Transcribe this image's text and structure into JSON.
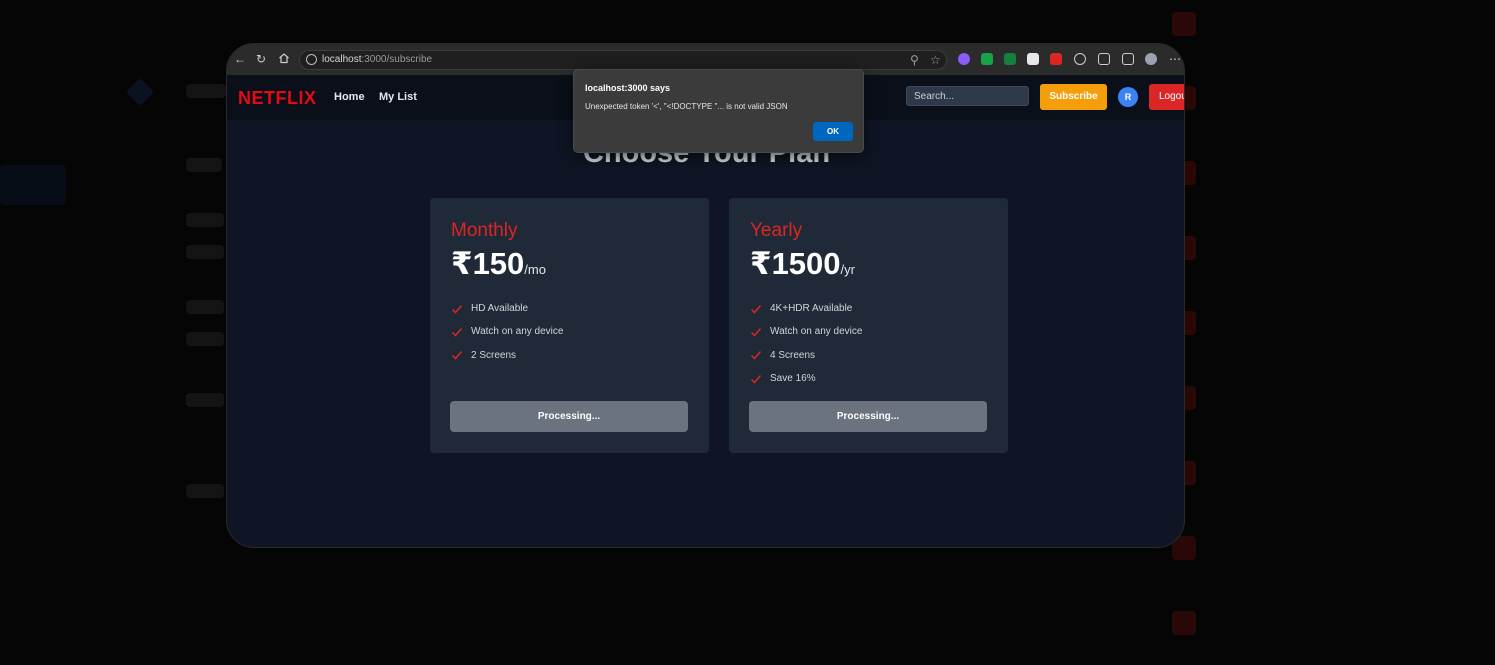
{
  "browser": {
    "url_host": "localhost",
    "url_path": ":3000/subscribe"
  },
  "app": {
    "logo": "NETFLIX",
    "nav": {
      "home": "Home",
      "my_list": "My List"
    },
    "search_placeholder": "Search...",
    "subscribe_label": "Subscribe",
    "avatar_initial": "R",
    "logout_label": "Logou",
    "brand_color": "#e50914"
  },
  "page": {
    "title": "Choose Your Plan"
  },
  "plans": [
    {
      "name": "Monthly",
      "amount": "₹150",
      "period": "/mo",
      "features": [
        "HD Available",
        "Watch on any device",
        "2 Screens"
      ],
      "button": "Processing..."
    },
    {
      "name": "Yearly",
      "amount": "₹1500",
      "period": "/yr",
      "features": [
        "4K+HDR Available",
        "Watch on any device",
        "4 Screens",
        "Save 16%"
      ],
      "button": "Processing..."
    }
  ],
  "alert": {
    "title": "localhost:3000 says",
    "message": "Unexpected token '<', \"<!DOCTYPE \"... is not valid JSON",
    "ok_label": "OK"
  }
}
